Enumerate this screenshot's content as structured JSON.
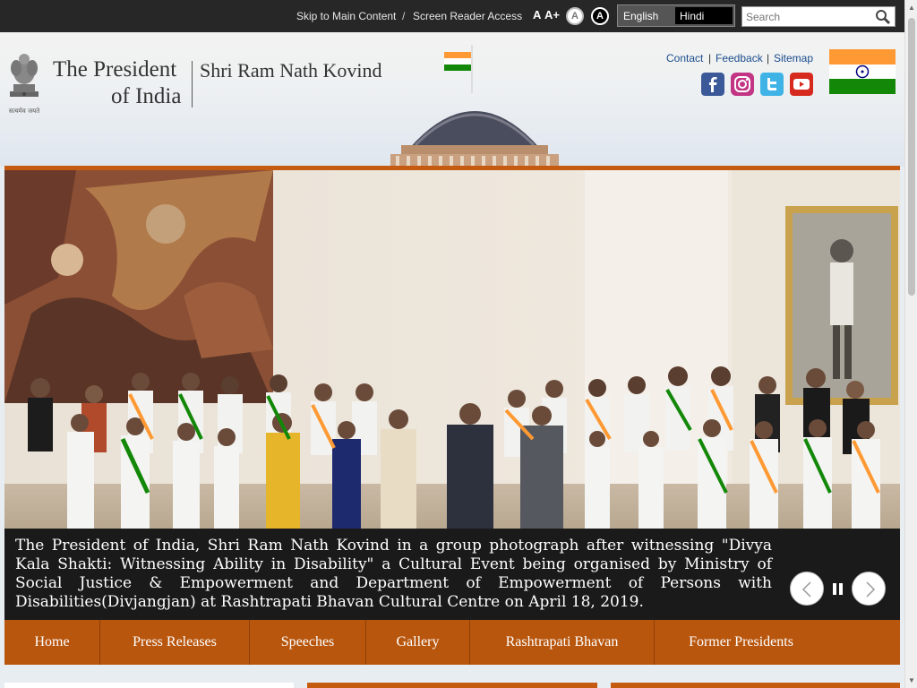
{
  "topbar": {
    "skip_link": "Skip to Main Content",
    "separator": "/",
    "screen_reader": "Screen Reader Access",
    "font_decrease": "A",
    "font_increase": "A+",
    "contrast_normal": "A",
    "contrast_high": "A",
    "lang_english": "English",
    "lang_hindi": "Hindi",
    "search_placeholder": "Search"
  },
  "header": {
    "title_line1": "The President",
    "title_line2": "of India",
    "subtitle": "Shri Ram Nath Kovind",
    "emblem_motto": "सत्यमेव जयते",
    "links": [
      "Contact",
      "Feedback",
      "Sitemap"
    ],
    "link_separator": "|",
    "social_icons": [
      "facebook-icon",
      "instagram-icon",
      "twitter-icon",
      "youtube-icon"
    ]
  },
  "slider": {
    "caption": "The President of India, Shri Ram Nath Kovind in a group photograph after witnessing \"Divya Kala Shakti: Witnessing Ability in Disability\" a Cultural Event being organised by Ministry of Social Justice & Empowerment and Department of Empowerment of Persons with Disabilities(Divjangjan) at Rashtrapati Bhavan Cultural Centre on April 18, 2019.",
    "controls": [
      "prev-icon",
      "pause-icon",
      "next-icon"
    ]
  },
  "nav": {
    "items": [
      "Home",
      "Press Releases",
      "Speeches",
      "Gallery",
      "Rashtrapati Bhavan",
      "Former Presidents"
    ]
  },
  "colors": {
    "accent": "#c55a11",
    "nav_bg": "#b8560e",
    "topbar_bg": "#272727",
    "link": "#1a4b8c"
  }
}
